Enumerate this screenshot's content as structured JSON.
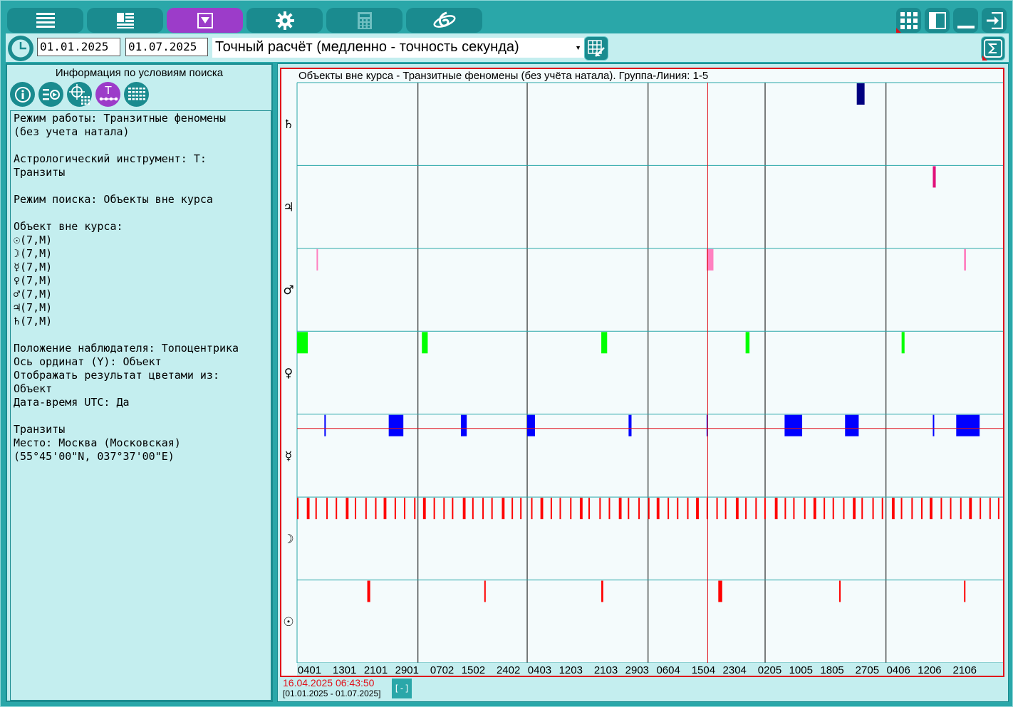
{
  "toolbar": {
    "tabs": [
      {
        "icon": "list-icon"
      },
      {
        "icon": "dashboard-icon"
      },
      {
        "icon": "filter-icon",
        "active": true
      },
      {
        "icon": "gear-icon"
      },
      {
        "icon": "calculator-icon"
      },
      {
        "icon": "logo-icon"
      }
    ],
    "right": [
      {
        "icon": "grid-icon"
      },
      {
        "icon": "panel-icon"
      },
      {
        "icon": "minimize-icon"
      },
      {
        "icon": "exit-icon"
      }
    ]
  },
  "controls": {
    "date_from": "01.01.2025",
    "date_to": "01.07.2025",
    "mode": "Точный расчёт (медленно - точность секунда)",
    "sum_icon": "sigma-icon"
  },
  "left_panel": {
    "title": "Информация по условиям поиска",
    "buttons": [
      {
        "icon": "info-icon"
      },
      {
        "icon": "export-icon"
      },
      {
        "icon": "crosshair-grid-icon"
      },
      {
        "icon": "transit-icon",
        "label": "T",
        "active": true
      },
      {
        "icon": "list-lines-icon"
      }
    ],
    "info_text": "Режим работы: Транзитные феномены\n(без учета натала)\n\nАстрологический инструмент: Т:\nТранзиты\n\nРежим поиска: Объекты вне курса\n\nОбъект вне курса:\n☉(7,M)\n☽(7,M)\n☿(7,M)\n♀(7,M)\n♂(7,M)\n♃(7,M)\n♄(7,M)\n\nПоложение наблюдателя: Топоцентрика\nОсь ординат (Y): Объект\nОтображать результат цветами из:\nОбъект\nДата-время UTC: Да\n\nТранзиты\nМесто: Москва (Московская)\n(55°45'00\"N, 037°37'00\"E)"
  },
  "status": {
    "current_datetime": "16.04.2025 06:43:50",
    "range": "[01.01.2025 - 01.07.2025]",
    "collapse_label": "[-]"
  },
  "colors": {
    "teal": "#2aa7a9",
    "teal_dark": "#1a8b8f",
    "panel_bg": "#c4eeef",
    "active_purple": "#9c3cc9",
    "cursor_red": "#e0101a"
  },
  "chart_data": {
    "type": "timeline",
    "title": "Объекты вне курса - Транзитные феномены (без учёта натала). Группа-Линия: 1-5",
    "x_range": [
      "01.01.2025",
      "01.07.2025"
    ],
    "x_tick_labels": [
      "0401",
      "1301",
      "2101",
      "2901",
      "0702",
      "1502",
      "2402",
      "0403",
      "1203",
      "2103",
      "2903",
      "0604",
      "1504",
      "2304",
      "0205",
      "1005",
      "1805",
      "2705",
      "0406",
      "1206",
      "2106"
    ],
    "month_boundaries": [
      "01.02",
      "01.03",
      "01.04",
      "01.05",
      "01.06"
    ],
    "cursor_date": "16.04.2025 06:43:50",
    "rows": [
      {
        "symbol": "♄",
        "color": "#000080",
        "intervals": [
          [
            "24.05.2025 12:00",
            "26.05.2025 12:00"
          ]
        ]
      },
      {
        "symbol": "♃",
        "color": "#e0107a",
        "intervals": [
          [
            "13.06.2025 00:00",
            "13.06.2025 18:00"
          ]
        ]
      },
      {
        "symbol": "♂",
        "color": "#ff80c0",
        "intervals": [
          [
            "06.01.2025 00:00",
            "06.01.2025 06:00"
          ],
          [
            "16.04.2025 00:00",
            "17.04.2025 18:00"
          ],
          [
            "21.06.2025 00:00",
            "21.06.2025 12:00"
          ]
        ]
      },
      {
        "symbol": "♀",
        "color": "#00ff00",
        "intervals": [
          [
            "01.01.2025 00:00",
            "03.01.2025 18:00"
          ],
          [
            "02.02.2025 00:00",
            "03.02.2025 12:00"
          ],
          [
            "20.03.2025 00:00",
            "21.03.2025 12:00"
          ],
          [
            "26.04.2025 00:00",
            "27.04.2025 00:00"
          ],
          [
            "05.06.2025 00:00",
            "05.06.2025 18:00"
          ]
        ]
      },
      {
        "symbol": "☿",
        "color": "#0000ff",
        "intervals": [
          [
            "08.01.2025 00:00",
            "08.01.2025 06:00"
          ],
          [
            "24.01.2025 12:00",
            "28.01.2025 06:00"
          ],
          [
            "12.02.2025 00:00",
            "13.02.2025 12:00"
          ],
          [
            "01.03.2025 00:00",
            "03.03.2025 00:00"
          ],
          [
            "27.03.2025 00:00",
            "27.03.2025 18:00"
          ],
          [
            "16.04.2025 00:00",
            "16.04.2025 04:00"
          ],
          [
            "06.05.2025 00:00",
            "10.05.2025 12:00"
          ],
          [
            "21.05.2025 12:00",
            "25.05.2025 00:00"
          ],
          [
            "13.06.2025 00:00",
            "13.06.2025 06:00"
          ],
          [
            "19.06.2025 00:00",
            "25.06.2025 00:00"
          ]
        ]
      },
      {
        "symbol": "☽",
        "color": "#ff0000",
        "note": "frequent short out-of-course periods (≈ every 2–3 days)"
      },
      {
        "symbol": "☉",
        "color": "#ff0000",
        "intervals": [
          [
            "19.01.2025 00:00",
            "19.01.2025 18:00"
          ],
          [
            "18.02.2025 00:00",
            "18.02.2025 08:00"
          ],
          [
            "20.03.2025 00:00",
            "20.03.2025 12:00"
          ],
          [
            "19.04.2025 00:00",
            "20.04.2025 00:00"
          ],
          [
            "20.05.2025 00:00",
            "20.05.2025 06:00"
          ],
          [
            "21.06.2025 00:00",
            "21.06.2025 06:00"
          ]
        ]
      }
    ]
  }
}
